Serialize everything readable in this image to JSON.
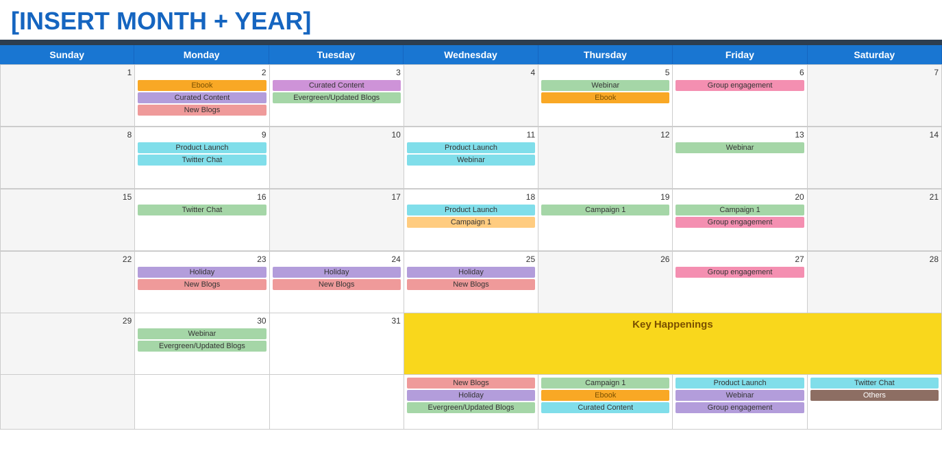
{
  "title": "[INSERT MONTH + YEAR]",
  "days": [
    "Sunday",
    "Monday",
    "Tuesday",
    "Wednesday",
    "Thursday",
    "Friday",
    "Saturday"
  ],
  "weeks": [
    {
      "cells": [
        {
          "number": "1",
          "gray": true,
          "events": []
        },
        {
          "number": "2",
          "gray": false,
          "events": [
            {
              "label": "Ebook",
              "cls": "ev-yellow"
            },
            {
              "label": "Curated Content",
              "cls": "ev-lavender"
            },
            {
              "label": "New Blogs",
              "cls": "ev-salmon"
            }
          ]
        },
        {
          "number": "3",
          "gray": false,
          "events": [
            {
              "label": "Curated Content",
              "cls": "ev-purple-light"
            },
            {
              "label": "Evergreen/Updated Blogs",
              "cls": "ev-green-light"
            }
          ]
        },
        {
          "number": "4",
          "gray": true,
          "events": []
        },
        {
          "number": "5",
          "gray": false,
          "events": [
            {
              "label": "Webinar",
              "cls": "ev-green-light"
            },
            {
              "label": "Ebook",
              "cls": "ev-yellow"
            }
          ]
        },
        {
          "number": "6",
          "gray": false,
          "events": [
            {
              "label": "Group engagement",
              "cls": "ev-pink"
            }
          ]
        },
        {
          "number": "7",
          "gray": true,
          "events": []
        }
      ]
    },
    {
      "cells": [
        {
          "number": "8",
          "gray": true,
          "events": []
        },
        {
          "number": "9",
          "gray": false,
          "events": [
            {
              "label": "Product Launch",
              "cls": "ev-cyan"
            },
            {
              "label": "Twitter Chat",
              "cls": "ev-cyan"
            }
          ]
        },
        {
          "number": "10",
          "gray": true,
          "events": []
        },
        {
          "number": "11",
          "gray": false,
          "events": [
            {
              "label": "Product Launch",
              "cls": "ev-cyan"
            },
            {
              "label": "Webinar",
              "cls": "ev-cyan"
            }
          ]
        },
        {
          "number": "12",
          "gray": true,
          "events": []
        },
        {
          "number": "13",
          "gray": false,
          "events": [
            {
              "label": "Webinar",
              "cls": "ev-green-light"
            }
          ]
        },
        {
          "number": "14",
          "gray": true,
          "events": []
        }
      ]
    },
    {
      "cells": [
        {
          "number": "15",
          "gray": true,
          "events": []
        },
        {
          "number": "16",
          "gray": false,
          "events": [
            {
              "label": "Twitter Chat",
              "cls": "ev-green-light"
            }
          ]
        },
        {
          "number": "17",
          "gray": true,
          "events": []
        },
        {
          "number": "18",
          "gray": false,
          "events": [
            {
              "label": "Product Launch",
              "cls": "ev-cyan"
            },
            {
              "label": "Campaign 1",
              "cls": "ev-peach"
            }
          ]
        },
        {
          "number": "19",
          "gray": false,
          "events": [
            {
              "label": "Campaign 1",
              "cls": "ev-green-light"
            }
          ]
        },
        {
          "number": "20",
          "gray": false,
          "events": [
            {
              "label": "Campaign 1",
              "cls": "ev-green-light"
            },
            {
              "label": "Group engagement",
              "cls": "ev-pink"
            }
          ]
        },
        {
          "number": "21",
          "gray": true,
          "events": []
        }
      ]
    },
    {
      "cells": [
        {
          "number": "22",
          "gray": true,
          "events": []
        },
        {
          "number": "23",
          "gray": false,
          "events": [
            {
              "label": "Holiday",
              "cls": "ev-lavender"
            },
            {
              "label": "New Blogs",
              "cls": "ev-salmon"
            }
          ]
        },
        {
          "number": "24",
          "gray": false,
          "events": [
            {
              "label": "Holiday",
              "cls": "ev-lavender"
            },
            {
              "label": "New Blogs",
              "cls": "ev-salmon"
            }
          ]
        },
        {
          "number": "25",
          "gray": false,
          "events": [
            {
              "label": "Holiday",
              "cls": "ev-lavender"
            },
            {
              "label": "New Blogs",
              "cls": "ev-salmon"
            }
          ]
        },
        {
          "number": "26",
          "gray": true,
          "events": []
        },
        {
          "number": "27",
          "gray": false,
          "events": [
            {
              "label": "Group engagement",
              "cls": "ev-pink"
            }
          ]
        },
        {
          "number": "28",
          "gray": true,
          "events": []
        }
      ]
    }
  ],
  "week5": {
    "sun": {
      "number": "29",
      "gray": true
    },
    "mon": {
      "number": "30",
      "events": [
        {
          "label": "Webinar",
          "cls": "ev-green-light"
        },
        {
          "label": "Evergreen/Updated Blogs",
          "cls": "ev-green-light"
        }
      ]
    },
    "tue": {
      "number": "31",
      "events": []
    },
    "key_label": "Key Happenings",
    "key_cols": [
      {
        "events": [
          {
            "label": "New Blogs",
            "cls": "ev-salmon"
          },
          {
            "label": "Holiday",
            "cls": "ev-lavender"
          },
          {
            "label": "Evergreen/Updated Blogs",
            "cls": "ev-green-light"
          }
        ]
      },
      {
        "events": [
          {
            "label": "Campaign 1",
            "cls": "ev-green-light"
          },
          {
            "label": "Ebook",
            "cls": "ev-yellow"
          },
          {
            "label": "Curated Content",
            "cls": "ev-cyan"
          }
        ]
      },
      {
        "events": [
          {
            "label": "Product Launch",
            "cls": "ev-cyan"
          },
          {
            "label": "Webinar",
            "cls": "ev-lavender"
          },
          {
            "label": "Group engagement",
            "cls": "ev-lavender"
          }
        ]
      },
      {
        "events": [
          {
            "label": "Twitter Chat",
            "cls": "ev-cyan"
          },
          {
            "label": "Others",
            "cls": "ev-brown"
          }
        ]
      }
    ]
  }
}
